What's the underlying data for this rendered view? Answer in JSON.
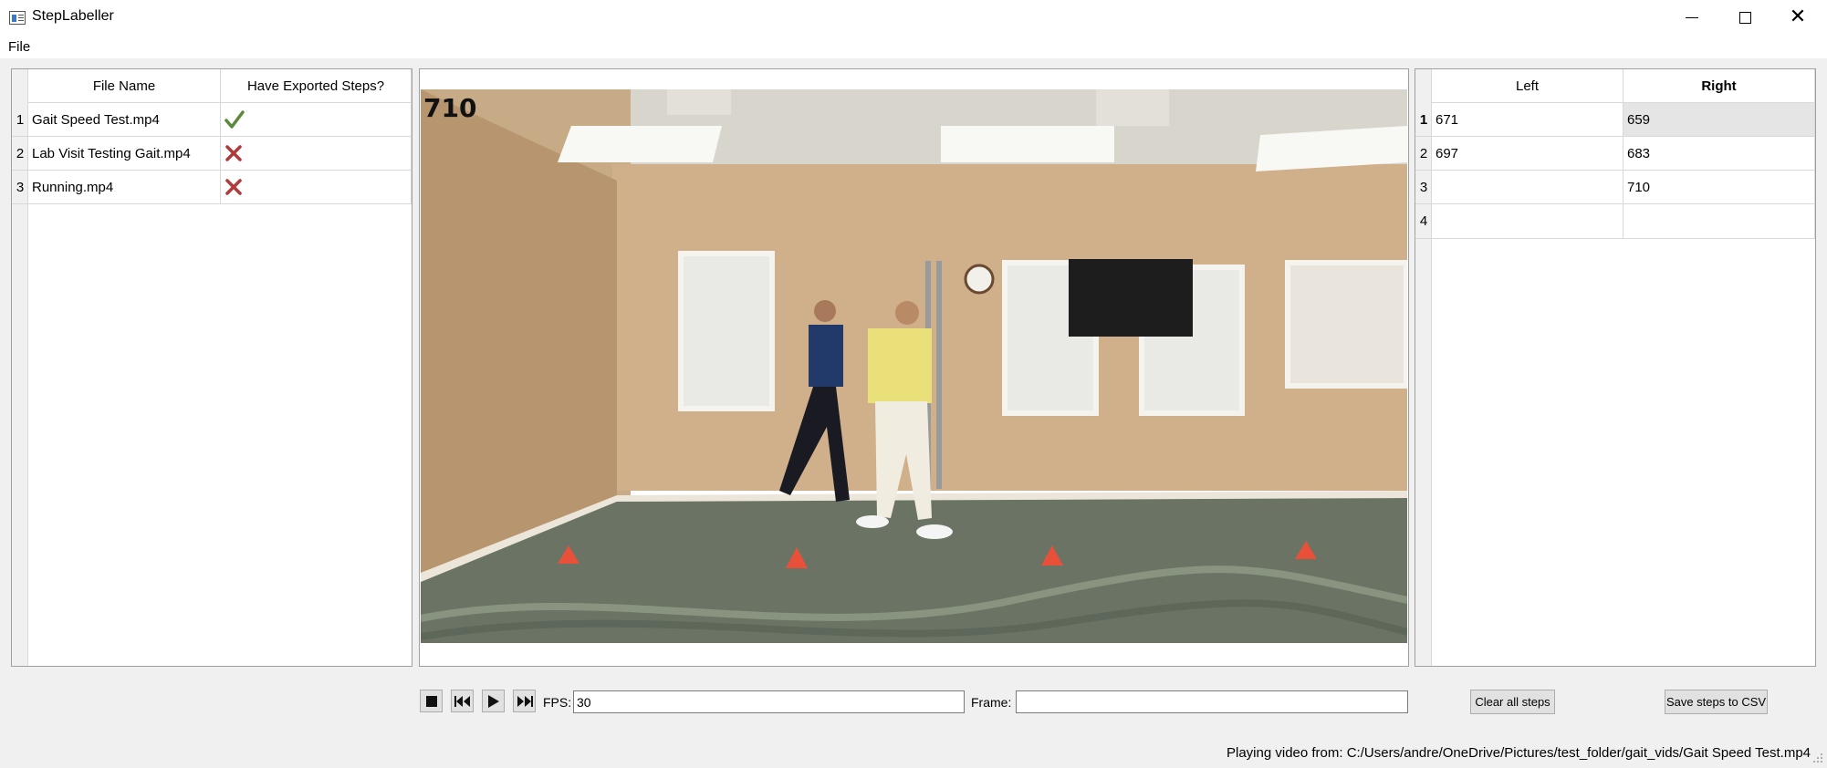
{
  "window": {
    "title": "StepLabeller",
    "icon": "app-window-icon",
    "controls": [
      "minimize-icon",
      "maximize-icon",
      "close-icon"
    ]
  },
  "menu": {
    "file": "File"
  },
  "file_table": {
    "headers": [
      "File Name",
      "Have Exported Steps?"
    ],
    "rows": [
      {
        "num": "1",
        "name": "Gait Speed Test.mp4",
        "exported": true,
        "status_icon": "checkmark-icon"
      },
      {
        "num": "2",
        "name": "Lab Visit Testing Gait.mp4",
        "exported": false,
        "status_icon": "cross-icon"
      },
      {
        "num": "3",
        "name": "Running.mp4",
        "exported": false,
        "status_icon": "cross-icon"
      }
    ],
    "colors": {
      "check": "#5a8a3a",
      "cross": "#b03a3a"
    }
  },
  "video": {
    "frame_overlay": "710"
  },
  "steps_table": {
    "headers": [
      "Left",
      "Right"
    ],
    "selected_row": 1,
    "rows": [
      {
        "num": "1",
        "left": "671",
        "right": "659"
      },
      {
        "num": "2",
        "left": "697",
        "right": "683"
      },
      {
        "num": "3",
        "left": "",
        "right": "710"
      },
      {
        "num": "4",
        "left": "",
        "right": ""
      }
    ]
  },
  "controls": {
    "buttons": [
      "stop-icon",
      "skip-back-icon",
      "play-icon",
      "skip-forward-icon"
    ],
    "fps_label": "FPS:",
    "fps_value": "30",
    "frame_label": "Frame:",
    "frame_value": "",
    "clear_button": "Clear all steps",
    "save_button": "Save steps to CSV"
  },
  "status": {
    "text": "Playing video from: C:/Users/andre/OneDrive/Pictures/test_folder/gait_vids/Gait Speed Test.mp4"
  }
}
